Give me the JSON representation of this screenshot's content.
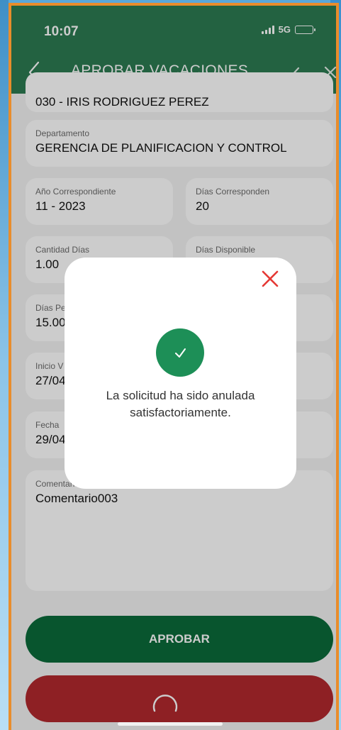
{
  "status_bar": {
    "time": "10:07",
    "network": "5G"
  },
  "nav": {
    "title": "APROBAR VACACIONES"
  },
  "form": {
    "employee_partial": "030 - IRIS RODRIGUEZ PEREZ",
    "departamento": {
      "label": "Departamento",
      "value": "GERENCIA DE PLANIFICACION Y CONTROL"
    },
    "ano": {
      "label": "Año Correspondiente",
      "value": "11 - 2023"
    },
    "dias_corresponden": {
      "label": "Días Corresponden",
      "value": "20"
    },
    "cantidad": {
      "label": "Cantidad Días",
      "value": "1.00"
    },
    "dias_disponible": {
      "label": "Días Disponible",
      "value": ""
    },
    "dias_pend": {
      "label": "Días Pe",
      "value": "15.00"
    },
    "inicio": {
      "label": "Inicio V",
      "value": "27/04"
    },
    "fecha": {
      "label": "Fecha",
      "value": "29/04"
    },
    "comentario": {
      "label": "Comentario",
      "value": "Comentario003"
    }
  },
  "buttons": {
    "approve": "APROBAR",
    "reject": ""
  },
  "modal": {
    "message": "La solicitud ha sido anulada satisfactoriamente."
  },
  "colors": {
    "header": "#2c7b52",
    "approve": "#0b6b3a",
    "reject": "#b2282e",
    "success": "#1d8f57",
    "close": "#e53935"
  }
}
